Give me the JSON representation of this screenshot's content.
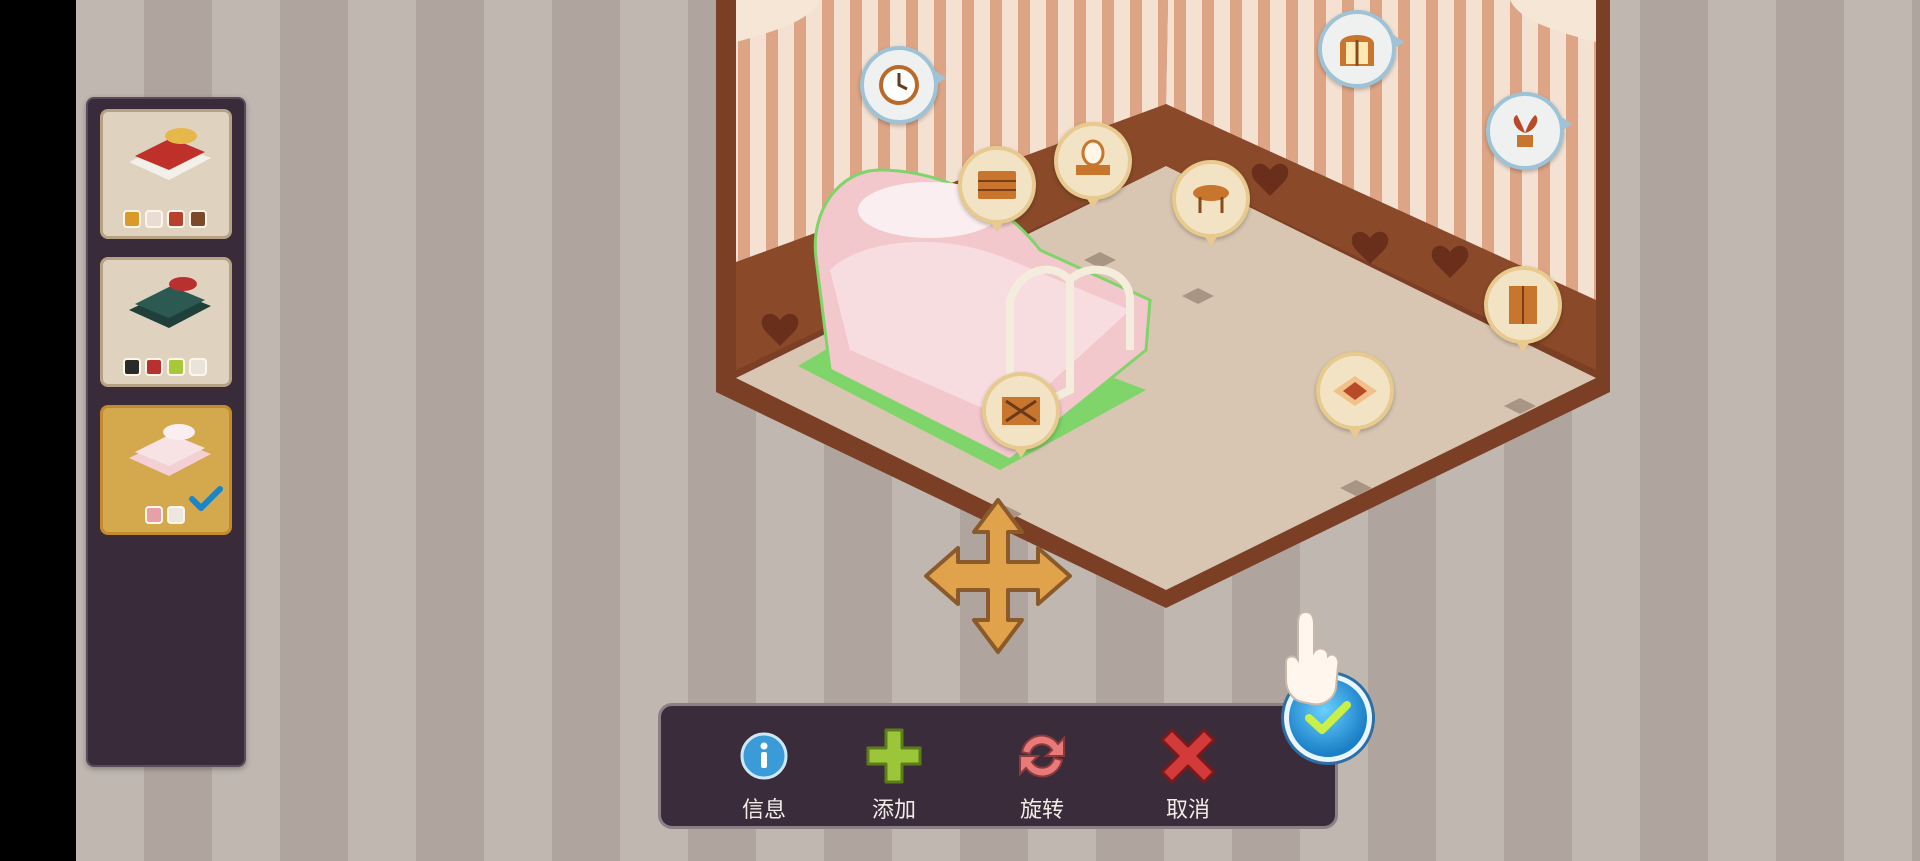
{
  "colors": {
    "panel_bg": "#3a2b3a",
    "card_bg": "#dfd2bf",
    "card_selected_bg": "#d4a94e",
    "toolbar_bg": "#3b2c3b",
    "toolbar_text": "#f2ece6",
    "floor": "#e8d6c2",
    "wall_stripe_a": "#f3dccb",
    "wall_stripe_b": "#d9a183",
    "selection_green": "#7fd46a",
    "confirm_blue": "#1a7fc6"
  },
  "side_panel": {
    "cards": [
      {
        "name": "red-bed",
        "swatches": [
          "#d99a28",
          "#e8dcd4",
          "#b8402d",
          "#7a4a2a"
        ],
        "selected": false
      },
      {
        "name": "dark-green-bed",
        "swatches": [
          "#2a2a2a",
          "#b83030",
          "#a8c83a",
          "#e8e4dc"
        ],
        "selected": false
      },
      {
        "name": "pink-bed",
        "swatches": [
          "#e8a0a8",
          "#efe6e0"
        ],
        "selected": true
      }
    ]
  },
  "room": {
    "bubbles": [
      {
        "name": "clock-icon",
        "style": "blue"
      },
      {
        "name": "window-icon",
        "style": "blue"
      },
      {
        "name": "plant-icon",
        "style": "blue"
      },
      {
        "name": "dresser-icon",
        "style": "gold"
      },
      {
        "name": "vanity-mirror-icon",
        "style": "gold"
      },
      {
        "name": "round-table-icon",
        "style": "gold"
      },
      {
        "name": "wardrobe-icon",
        "style": "gold"
      },
      {
        "name": "rug-icon",
        "style": "gold"
      },
      {
        "name": "bed-end-icon",
        "style": "gold"
      }
    ]
  },
  "toolbar": {
    "info_label": "信息",
    "add_label": "添加",
    "rotate_label": "旋转",
    "cancel_label": "取消"
  }
}
